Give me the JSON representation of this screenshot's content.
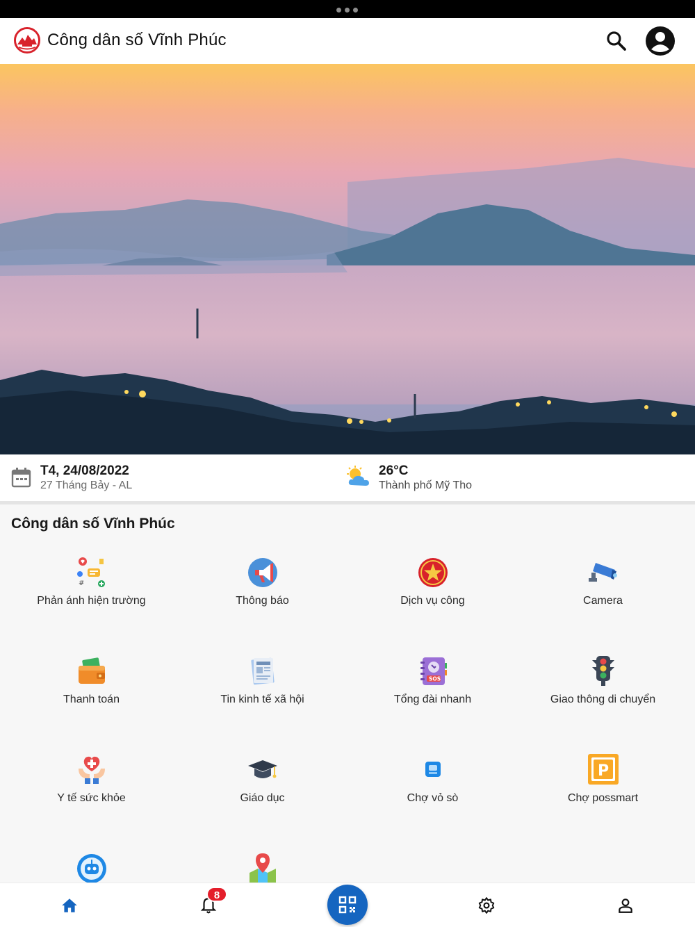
{
  "app_bar": {
    "title": "Công dân số Vĩnh Phúc",
    "icons": [
      "logo",
      "search-icon",
      "account-circle-icon"
    ]
  },
  "banner": {
    "icon": "landscape-banner"
  },
  "info": {
    "date": "T4, 24/08/2022",
    "lunar_date": "27 Tháng Bảy - AL",
    "temperature": "26°C",
    "city": "Thành phố Mỹ Tho"
  },
  "section": {
    "title": "Công dân số Vĩnh Phúc"
  },
  "services": [
    {
      "label": "Phản ánh hiện trường",
      "icon": "feedback-icon"
    },
    {
      "label": "Thông báo",
      "icon": "megaphone-icon"
    },
    {
      "label": "Dịch vụ công",
      "icon": "emblem-icon"
    },
    {
      "label": "Camera",
      "icon": "camera-icon"
    },
    {
      "label": "Thanh toán",
      "icon": "wallet-icon"
    },
    {
      "label": "Tin kinh tế xã hội",
      "icon": "newspaper-icon"
    },
    {
      "label": "Tổng đài nhanh",
      "icon": "sos-phonebook-icon"
    },
    {
      "label": "Giao thông di chuyển",
      "icon": "traffic-light-icon"
    },
    {
      "label": "Y tế sức khỏe",
      "icon": "health-icon"
    },
    {
      "label": "Giáo dục",
      "icon": "graduation-cap-icon"
    },
    {
      "label": "Chợ vỏ sò",
      "icon": "market-app-icon"
    },
    {
      "label": "Chợ possmart",
      "icon": "possmart-icon"
    },
    {
      "label": "",
      "icon": "chatbot-icon"
    },
    {
      "label": "",
      "icon": "map-pin-icon"
    }
  ],
  "bottom_nav": {
    "notification_count": "8",
    "items": [
      "home-icon",
      "bell-icon",
      "qr-code-icon",
      "settings-icon",
      "profile-icon"
    ]
  },
  "colors": {
    "primary": "#1565c0",
    "badge": "#e41e2b",
    "logo_red": "#d8222b"
  }
}
